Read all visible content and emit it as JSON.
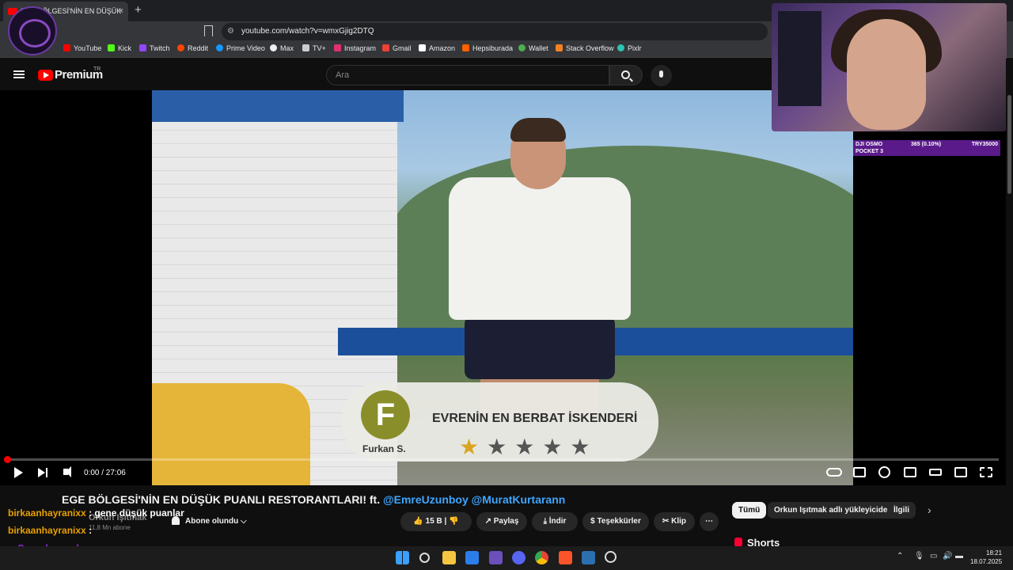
{
  "browser": {
    "tab_title": "EGE BÖLGESİ'NİN EN DÜŞÜK",
    "tab_close": "×",
    "new_tab": "+",
    "url": "youtube.com/watch?v=wmxGjig2DTQ",
    "bookmarks": [
      "YouTube",
      "Kick",
      "Twitch",
      "Reddit",
      "Prime Video",
      "Max",
      "TV+",
      "Instagram",
      "Gmail",
      "Amazon",
      "Hepsiburada",
      "Wallet",
      "Stack Overflow",
      "Pixlr"
    ]
  },
  "youtube": {
    "logo_text": "Premium",
    "region": "TR",
    "search_placeholder": "Ara"
  },
  "video": {
    "overlay_card": {
      "avatar_letter": "F",
      "reviewer": "Furkan S.",
      "headline": "EVRENİN EN BERBAT İSKENDERİ",
      "rating": 1,
      "max_rating": 5,
      "star_on": "★",
      "star_off": "★★★★"
    },
    "time": "0:00 / 27:06",
    "progress": 0.0
  },
  "webcam_alert": {
    "item": "DJI OSMO POCKET 3",
    "item_line1": "DJI OSMO",
    "item_line2": "POCKET 3",
    "bid": "365 (0.10%)",
    "goal": "TRY35000"
  },
  "below_video": {
    "title_plain": "EGE BÖLGESİ'NİN EN DÜŞÜK PUANLI RESTORANTLARI! ft.",
    "mention1": "@EmreUzunboy",
    "mention2": "@MuratKurtarann",
    "channel": "Orkun Işıtmak",
    "subscribers": "11,8 Mn abone",
    "subscribe_label": "Abone olundu",
    "likes": "15 B",
    "share": "Paylaş",
    "download": "İndir",
    "thanks": "Teşekkürler",
    "clip": "Klip",
    "more": "⋯"
  },
  "sidebar": {
    "chips": [
      "Tümü",
      "Orkun Işıtmak adlı yükleyiciden",
      "İlgili"
    ],
    "shorts_heading": "Shorts"
  },
  "chat": [
    {
      "user": "birkaanhayranixx",
      "msg": ": gene düşük puanlar"
    },
    {
      "user": "birkaanhayranixx",
      "msg": ":"
    }
  ],
  "sub_alert": "Son abone: ben_sra",
  "taskbar": {
    "time": "18:21",
    "date": "18.07.2025"
  },
  "colors": {
    "youtube_red": "#ff0000",
    "mention_blue": "#3ea6ff",
    "chat_user": "#e8a000",
    "sub_alert": "#8a2ae0",
    "star_gold": "#d9a520"
  }
}
